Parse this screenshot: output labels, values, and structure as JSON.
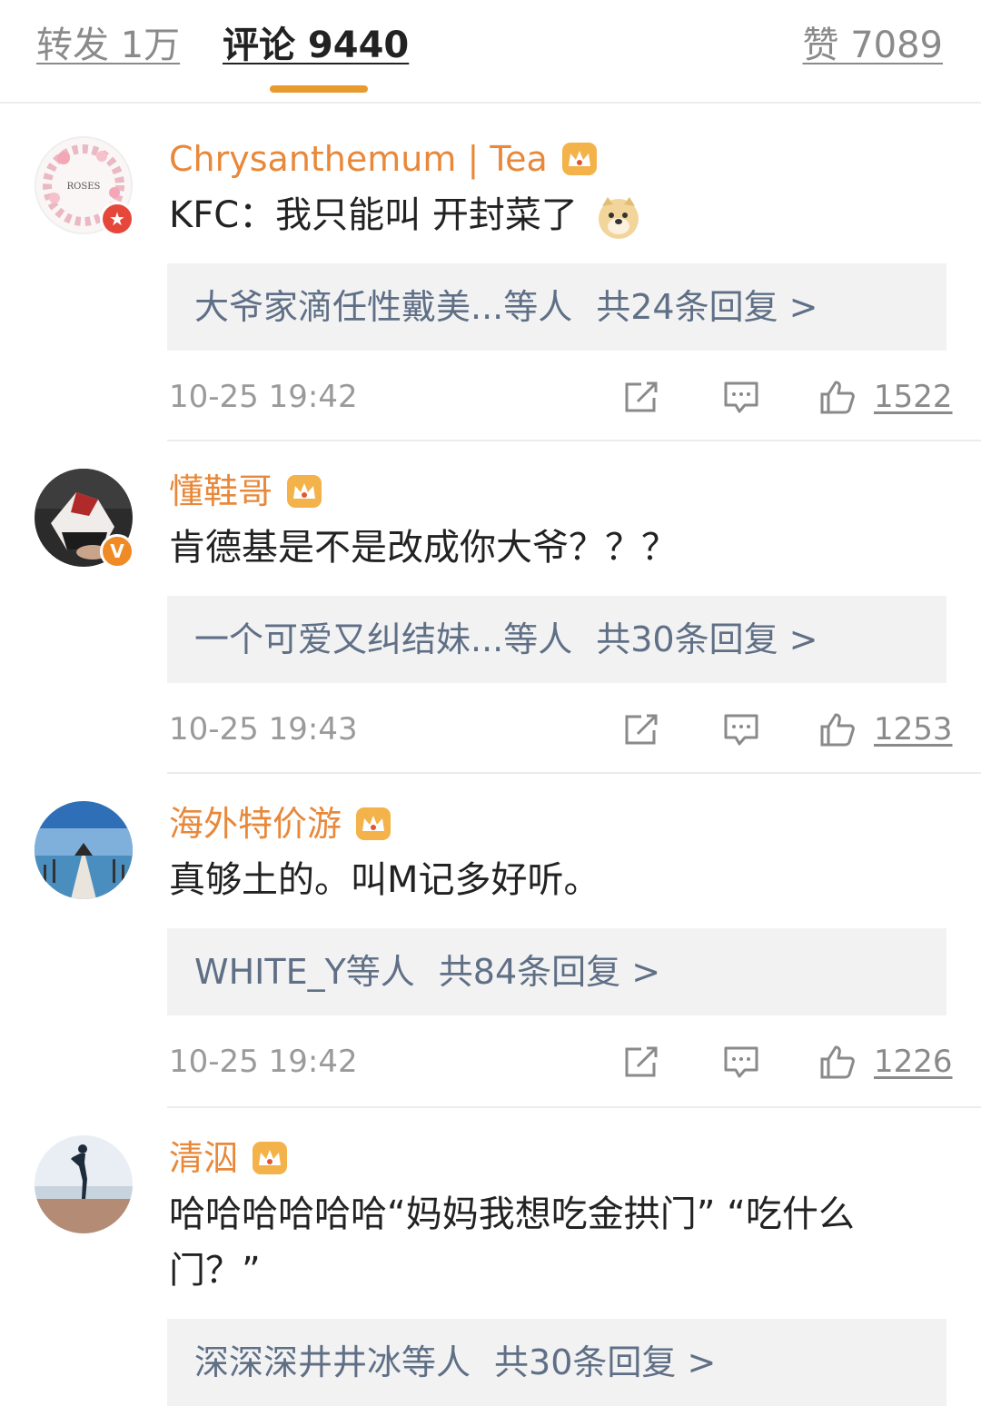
{
  "tabs": {
    "repost": "转发 1万",
    "comments": "评论 9440",
    "likes": "赞 7089"
  },
  "colors": {
    "accent": "#e89a2c",
    "username": "#e8883a",
    "reply_link": "#5f6f86",
    "muted": "#9a9a9a"
  },
  "comments": [
    {
      "username": "Chrysanthemum | Tea",
      "avatar_text": "ROSES",
      "text": "KFC：我只能叫 开封菜了",
      "replies_users": "大爷家滴任性戴美...等人",
      "replies_count": "共24条回复 >",
      "time": "10-25 19:42",
      "likes": "1522"
    },
    {
      "username": "懂鞋哥",
      "badge": "V",
      "text": "肯德基是不是改成你大爷？？？",
      "replies_users": "一个可爱又纠结妹...等人",
      "replies_count": "共30条回复 >",
      "time": "10-25 19:43",
      "likes": "1253"
    },
    {
      "username": "海外特价游",
      "text": "真够土的。叫M记多好听。",
      "replies_users": "WHITE_Y等人",
      "replies_count": "共84条回复 >",
      "time": "10-25 19:42",
      "likes": "1226"
    },
    {
      "username": "清泅",
      "text": "哈哈哈哈哈哈“妈妈我想吃金拱门” “吃什么门？”",
      "replies_users": "深深深井井冰等人",
      "replies_count": "共30条回复 >"
    }
  ]
}
